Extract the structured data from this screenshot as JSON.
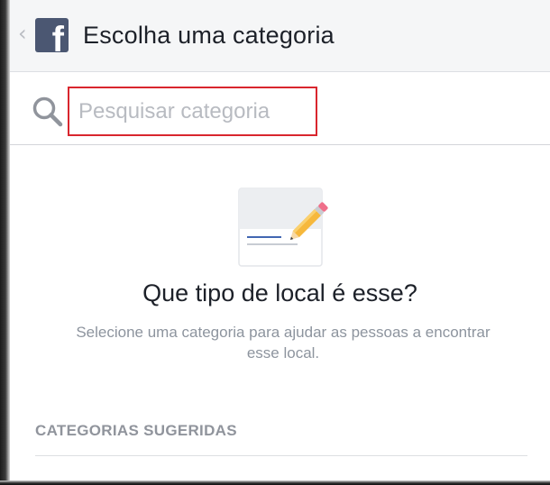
{
  "header": {
    "back_glyph": "‹",
    "logo_letter": "f",
    "title": "Escolha uma categoria"
  },
  "search": {
    "placeholder": "Pesquisar categoria",
    "value": "",
    "icon": "search-icon"
  },
  "empty_state": {
    "illustration_icon": "pencil-note-icon",
    "question": "Que tipo de local é esse?",
    "description": "Selecione uma categoria para ajudar as pessoas a encontrar esse local."
  },
  "suggested": {
    "heading": "CATEGORIAS SUGERIDAS"
  },
  "colors": {
    "brand": "#4b5772",
    "highlight_border": "#d9262e",
    "text_primary": "#1d2129",
    "text_secondary": "#8d949e"
  }
}
